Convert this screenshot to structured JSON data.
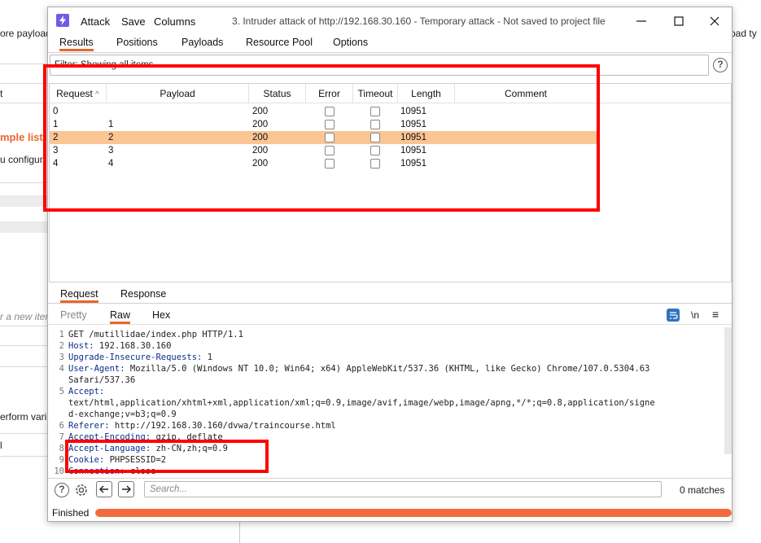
{
  "background": {
    "texts": [
      "ore payload",
      "oad ty",
      "t",
      "mple list",
      "u configur",
      "r a new item",
      "erform vario",
      "l"
    ]
  },
  "window": {
    "menu": [
      "Attack",
      "Save",
      "Columns"
    ],
    "title": "3. Intruder attack of http://192.168.30.160 - Temporary attack - Not saved to project file"
  },
  "tabs": [
    "Results",
    "Positions",
    "Payloads",
    "Resource Pool",
    "Options"
  ],
  "filter": {
    "text": "Filter: Showing all items",
    "help": "?"
  },
  "table": {
    "headers": [
      "Request",
      "Payload",
      "Status",
      "Error",
      "Timeout",
      "Length",
      "Comment"
    ],
    "sort_indicator": "^",
    "rows": [
      {
        "request": "0",
        "payload": "",
        "status": "200",
        "length": "10951"
      },
      {
        "request": "1",
        "payload": "1",
        "status": "200",
        "length": "10951"
      },
      {
        "request": "2",
        "payload": "2",
        "status": "200",
        "length": "10951"
      },
      {
        "request": "3",
        "payload": "3",
        "status": "200",
        "length": "10951"
      },
      {
        "request": "4",
        "payload": "4",
        "status": "200",
        "length": "10951"
      }
    ],
    "selected_row": 2,
    "selected_color": "#fbc594"
  },
  "message_tabs": [
    "Request",
    "Response"
  ],
  "view_tabs": [
    "Pretty",
    "Raw",
    "Hex"
  ],
  "editor_icons": {
    "newline": "\\n",
    "menu": "≡"
  },
  "request_lines": [
    {
      "n": "1",
      "key": "",
      "text": "GET /mutillidae/index.php HTTP/1.1"
    },
    {
      "n": "2",
      "key": "Host:",
      "text": " 192.168.30.160"
    },
    {
      "n": "3",
      "key": "Upgrade-Insecure-Requests:",
      "text": " 1"
    },
    {
      "n": "4",
      "key": "User-Agent:",
      "text": " Mozilla/5.0 (Windows NT 10.0; Win64; x64) AppleWebKit/537.36 (KHTML, like Gecko) Chrome/107.0.5304.63"
    },
    {
      "n": "",
      "key": "",
      "text": "Safari/537.36"
    },
    {
      "n": "5",
      "key": "Accept:",
      "text": ""
    },
    {
      "n": "",
      "key": "",
      "text": "text/html,application/xhtml+xml,application/xml;q=0.9,image/avif,image/webp,image/apng,*/*;q=0.8,application/signe"
    },
    {
      "n": "",
      "key": "",
      "text": "d-exchange;v=b3;q=0.9"
    },
    {
      "n": "6",
      "key": "Referer:",
      "text": " http://192.168.30.160/dvwa/traincourse.html"
    },
    {
      "n": "7",
      "key": "Accept-Encoding:",
      "text": " gzip, deflate"
    },
    {
      "n": "8",
      "key": "Accept-Language:",
      "text": " zh-CN,zh;q=0.9"
    },
    {
      "n": "9",
      "key": "Cookie:",
      "text": " PHPSESSID=2"
    },
    {
      "n": "10",
      "key": "Connection:",
      "text": " close"
    }
  ],
  "search": {
    "placeholder": "Search...",
    "matches": "0 matches"
  },
  "status": {
    "text": "Finished",
    "progress": 1.0
  },
  "colors": {
    "accent": "#e8672b",
    "progress": "#f36b3c",
    "highlight": "#ff0000",
    "selected_row": "#fbc594"
  }
}
